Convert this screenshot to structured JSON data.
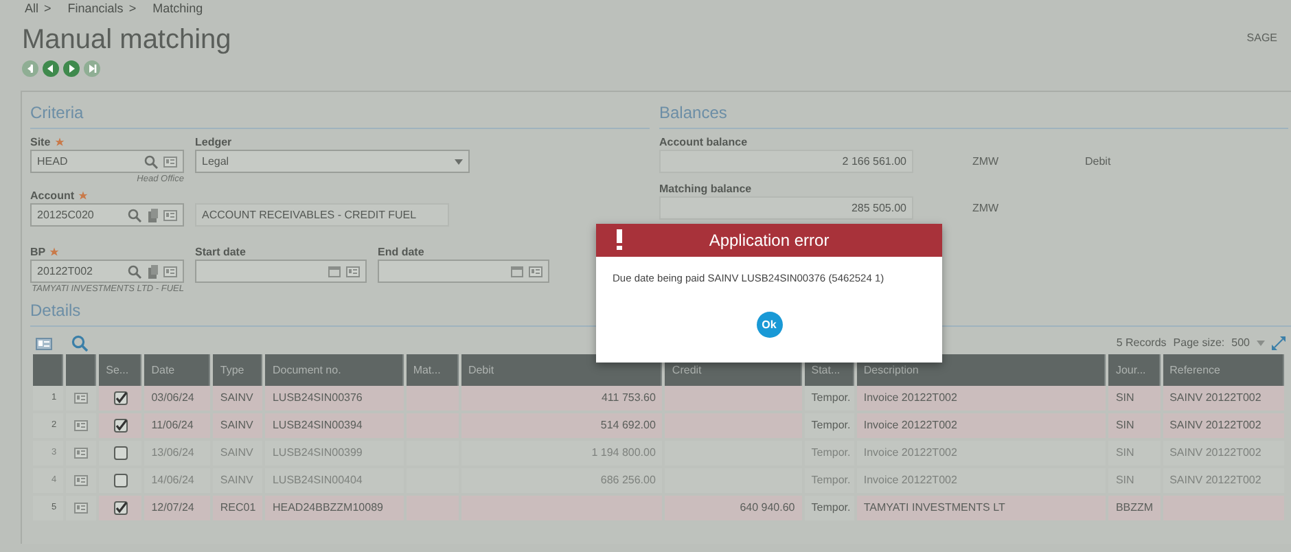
{
  "breadcrumb": [
    {
      "label": "All",
      "separator": ">"
    },
    {
      "label": "Financials",
      "separator": ">"
    },
    {
      "label": "Matching"
    }
  ],
  "page_title": "Manual matching",
  "company": "SAGE",
  "record_nav": [
    {
      "kind": "first",
      "disabled": true
    },
    {
      "kind": "previous",
      "disabled": false
    },
    {
      "kind": "next",
      "disabled": false
    },
    {
      "kind": "last",
      "disabled": true
    }
  ],
  "criteria": {
    "title": "Criteria",
    "site": {
      "label": "Site",
      "required": true,
      "value": "HEAD",
      "caption": "Head Office"
    },
    "ledger": {
      "label": "Ledger",
      "value": "Legal"
    },
    "account": {
      "label": "Account",
      "required": true,
      "value": "20125C020",
      "description": "ACCOUNT RECEIVABLES - CREDIT FUEL"
    },
    "bp": {
      "label": "BP",
      "required": true,
      "value": "20122T002",
      "caption": "TAMYATI INVESTMENTS LTD - FUEL"
    },
    "start_date": {
      "label": "Start date"
    },
    "end_date": {
      "label": "End date"
    }
  },
  "balances": {
    "title": "Balances",
    "account_balance": {
      "label": "Account balance",
      "value": "2 166 561.00",
      "currency": "ZMW",
      "sense": "Debit"
    },
    "matching_balance": {
      "label": "Matching balance",
      "value": "285 505.00",
      "currency": "ZMW"
    }
  },
  "details": {
    "title": "Details",
    "records": "5 Records",
    "page_size_label": "Page size:",
    "page_size": "500",
    "columns": [
      "Se...",
      "Date",
      "Type",
      "Document no.",
      "Mat...",
      "Debit",
      "Credit",
      "Stat...",
      "Description",
      "Jour...",
      "Reference"
    ],
    "rows": [
      {
        "number": "1",
        "checked": true,
        "date": "03/06/24",
        "type": "SAINV",
        "document_no": "LUSB24SIN00376",
        "debit": "411 753.60",
        "status": "Tempor.",
        "description": "Invoice 20122T002",
        "journal": "SIN",
        "reference": "SAINV 20122T002"
      },
      {
        "number": "2",
        "checked": true,
        "date": "11/06/24",
        "type": "SAINV",
        "document_no": "LUSB24SIN00394",
        "debit": "514 692.00",
        "status": "Tempor.",
        "description": "Invoice 20122T002",
        "journal": "SIN",
        "reference": "SAINV 20122T002"
      },
      {
        "number": "3",
        "checked": false,
        "date": "13/06/24",
        "type": "SAINV",
        "document_no": "LUSB24SIN00399",
        "debit": "1 194 800.00",
        "status": "Tempor.",
        "description": "Invoice 20122T002",
        "journal": "SIN",
        "reference": "SAINV 20122T002"
      },
      {
        "number": "4",
        "checked": false,
        "date": "14/06/24",
        "type": "SAINV",
        "document_no": "LUSB24SIN00404",
        "debit": "686 256.00",
        "status": "Tempor.",
        "description": "Invoice 20122T002",
        "journal": "SIN",
        "reference": "SAINV 20122T002"
      },
      {
        "number": "5",
        "checked": true,
        "date": "12/07/24",
        "type": "REC01",
        "document_no": "HEAD24BBZZM10089",
        "credit": "640 940.60",
        "status": "Tempor.",
        "description": "TAMYATI INVESTMENTS LT",
        "journal": "BBZZM"
      }
    ]
  },
  "dialog": {
    "title": "Application error",
    "message": "Due date being paid SAINV LUSB24SIN00376 (5462524 1)",
    "button": "Ok"
  }
}
